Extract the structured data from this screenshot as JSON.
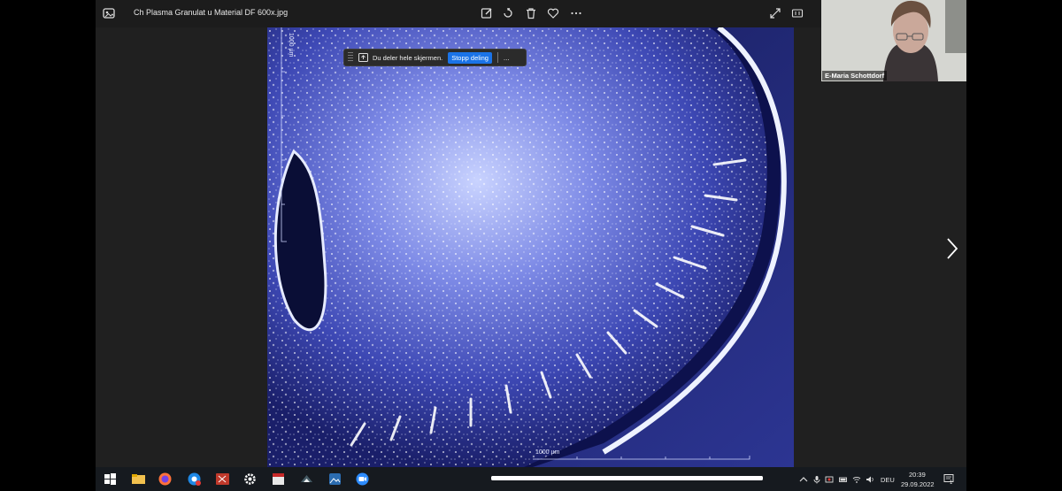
{
  "viewer": {
    "title": "Ch Plasma Granulat u Material DF 600x.jpg",
    "toolbar": [
      "edit-image-icon",
      "rotate-icon",
      "delete-icon",
      "favorite-icon",
      "more-icon"
    ],
    "right_controls": [
      "fullscreen-icon",
      "actual-size-icon"
    ]
  },
  "photo": {
    "scale_label_top": "1000 µm",
    "scale_label_bottom": "1000 µm"
  },
  "share_bar": {
    "message": "Du deler hele skjermen.",
    "stop_label": "Stopp deling",
    "more_label": "..."
  },
  "video": {
    "participant_name": "E-Maria Schottdorf"
  },
  "taskbar": {
    "apps": [
      "start-icon",
      "search-icon",
      "file-explorer-icon",
      "firefox-icon",
      "chrome-icon",
      "powerpoint-icon",
      "settings-icon",
      "calendar-icon",
      "paint-icon",
      "photos-icon",
      "zoom-icon"
    ],
    "progress": 1.0,
    "language": "DEU",
    "time": "20:39",
    "date": "29.09.2022",
    "notification_count": "1"
  },
  "colors": {
    "viewer_bg": "#202020",
    "accent": "#1a73e8",
    "taskbar": "#161a1f"
  }
}
